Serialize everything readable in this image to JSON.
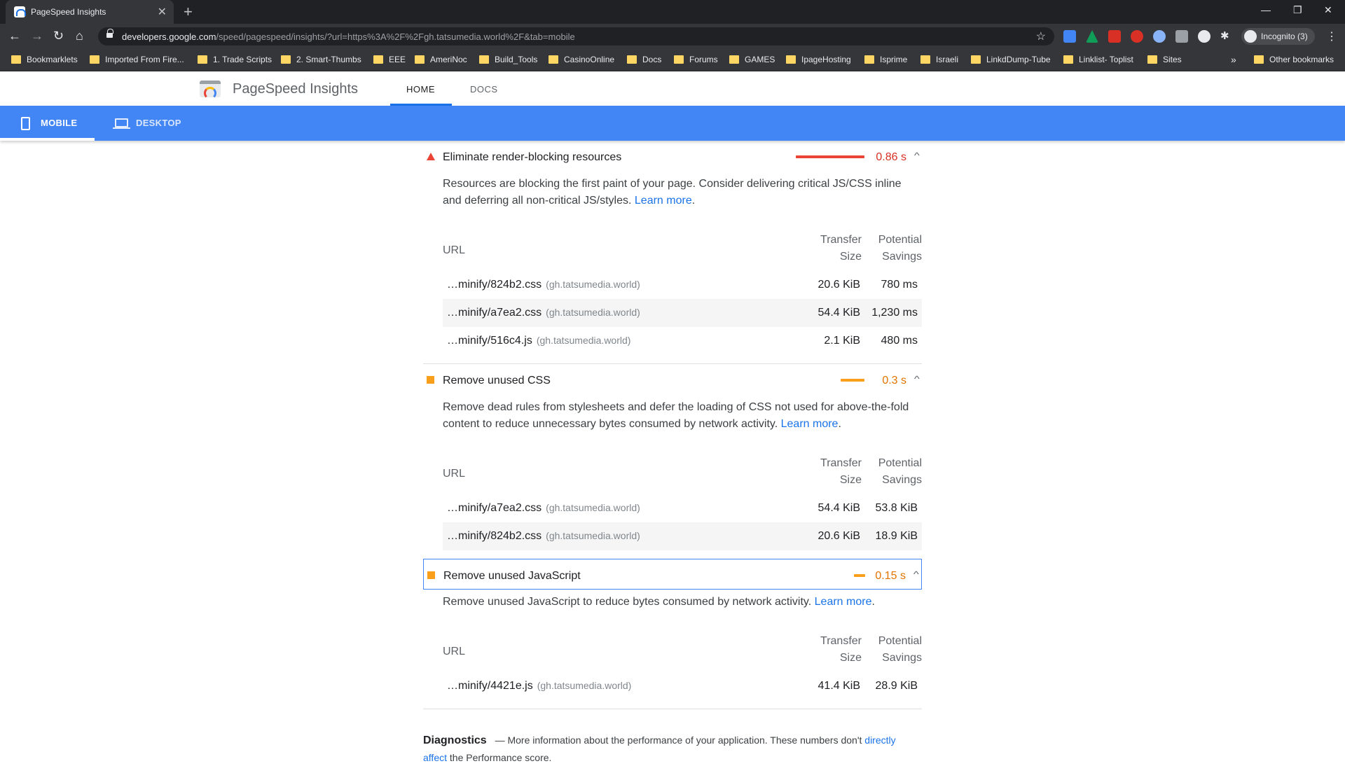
{
  "browser": {
    "tab_title": "PageSpeed Insights",
    "url_host": "developers.google.com",
    "url_path": "/speed/pagespeed/insights/?url=https%3A%2F%2Fgh.tatsumedia.world%2F&tab=mobile",
    "profile_label": "Incognito (3)",
    "bookmarks": [
      "Bookmarklets",
      "Imported From Fire...",
      "1. Trade Scripts",
      "2. Smart-Thumbs",
      "EEE",
      "AmeriNoc",
      "Build_Tools",
      "CasinoOnline",
      "Docs",
      "Forums",
      "GAMES",
      "IpageHosting",
      "Isprime",
      "Israeli",
      "LinkdDump-Tube",
      "Linklist- Toplist",
      "Sites"
    ],
    "other_bookmarks": "Other bookmarks",
    "more_chevron": "»"
  },
  "header": {
    "title": "PageSpeed Insights",
    "nav_home": "HOME",
    "nav_docs": "DOCS"
  },
  "devices": {
    "mobile": "MOBILE",
    "desktop": "DESKTOP"
  },
  "audits": [
    {
      "title": "Eliminate render-blocking resources",
      "savings": "0.86 s",
      "severity": "fail",
      "color": "#eb4335",
      "description": "Resources are blocking the first paint of your page. Consider delivering critical JS/CSS inline and deferring all non-critical JS/styles.",
      "learn_more": "Learn more",
      "col_url": "URL",
      "col_size_1": "Transfer",
      "col_size_2": "Size",
      "col_save_1": "Potential",
      "col_save_2": "Savings",
      "rows": [
        {
          "url": "…minify/824b2.css",
          "host": "(gh.tatsumedia.world)",
          "size": "20.6 KiB",
          "savings": "780 ms"
        },
        {
          "url": "…minify/a7ea2.css",
          "host": "(gh.tatsumedia.world)",
          "size": "54.4 KiB",
          "savings": "1,230 ms"
        },
        {
          "url": "…minify/516c4.js",
          "host": "(gh.tatsumedia.world)",
          "size": "2.1 KiB",
          "savings": "480 ms"
        }
      ]
    },
    {
      "title": "Remove unused CSS",
      "savings": "0.3 s",
      "severity": "average",
      "color": "#fa9f1b",
      "description": "Remove dead rules from stylesheets and defer the loading of CSS not used for above-the-fold content to reduce unnecessary bytes consumed by network activity.",
      "learn_more": "Learn more",
      "col_url": "URL",
      "col_size_1": "Transfer",
      "col_size_2": "Size",
      "col_save_1": "Potential",
      "col_save_2": "Savings",
      "rows": [
        {
          "url": "…minify/a7ea2.css",
          "host": "(gh.tatsumedia.world)",
          "size": "54.4 KiB",
          "savings": "53.8 KiB"
        },
        {
          "url": "…minify/824b2.css",
          "host": "(gh.tatsumedia.world)",
          "size": "20.6 KiB",
          "savings": "18.9 KiB"
        }
      ]
    },
    {
      "title": "Remove unused JavaScript",
      "savings": "0.15 s",
      "severity": "average",
      "color": "#fa9f1b",
      "description": "Remove unused JavaScript to reduce bytes consumed by network activity.",
      "learn_more": "Learn more",
      "col_url": "URL",
      "col_size_1": "Transfer",
      "col_size_2": "Size",
      "col_save_1": "Potential",
      "col_save_2": "Savings",
      "rows": [
        {
          "url": "…minify/4421e.js",
          "host": "(gh.tatsumedia.world)",
          "size": "41.4 KiB",
          "savings": "28.9 KiB"
        }
      ]
    }
  ],
  "diagnostics": {
    "title": "Diagnostics",
    "text": "— More information about the performance of your application. These numbers don't",
    "link": "directly affect",
    "tail": "the Performance score."
  }
}
